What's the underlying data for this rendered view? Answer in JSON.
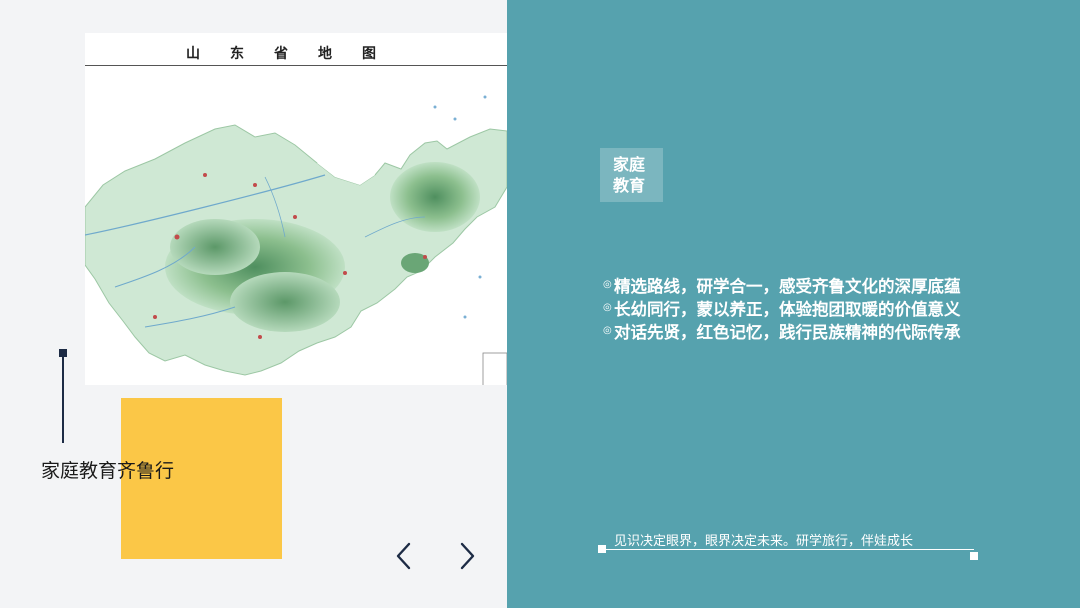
{
  "map": {
    "title": "山东省地图"
  },
  "left": {
    "caption": "家庭教育齐鲁行"
  },
  "nav": {
    "prev_icon": "chevron-left-icon",
    "next_icon": "chevron-right-icon"
  },
  "right": {
    "tag": {
      "line1": "家庭",
      "line2": "教育"
    },
    "bullets": [
      {
        "icon": "◎",
        "text": "精选路线，研学合一，感受齐鲁文化的深厚底蕴"
      },
      {
        "icon": "◎",
        "text": "长幼同行，蒙以养正，体验抱团取暖的价值意义"
      },
      {
        "icon": "◎",
        "text": "对话先贤，红色记忆，践行民族精神的代际传承"
      }
    ],
    "motto": "见识决定眼界，眼界决定未来。研学旅行，伴娃成长"
  },
  "colors": {
    "right_panel": "#56a2ae",
    "yellow_block": "#fbc747",
    "marker": "#1d2b45",
    "background": "#f3f4f6"
  }
}
